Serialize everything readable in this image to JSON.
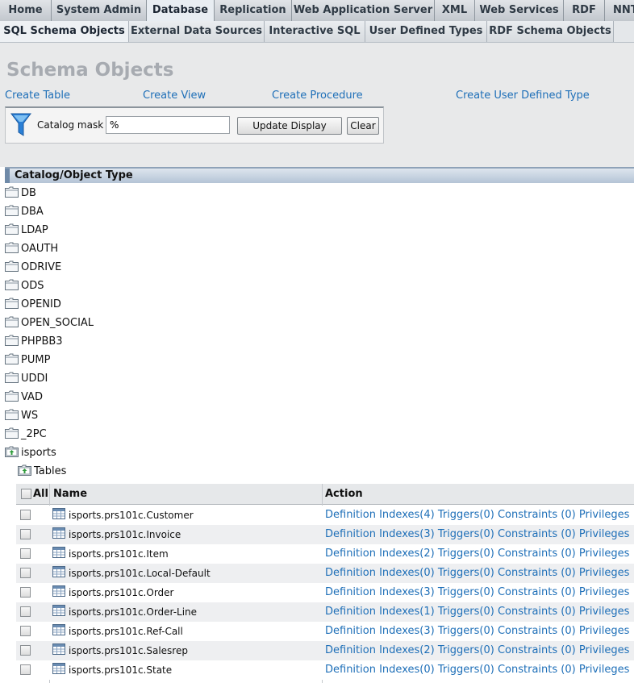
{
  "tabs": [
    "Home",
    "System Admin",
    "Database",
    "Replication",
    "Web Application Server",
    "XML",
    "Web Services",
    "RDF",
    "NNTP"
  ],
  "subtabs": [
    "SQL Schema Objects",
    "External Data Sources",
    "Interactive SQL",
    "User Defined Types",
    "RDF Schema Objects"
  ],
  "page_title": "Schema Objects",
  "create_links": [
    "Create Table",
    "Create View",
    "Create Procedure",
    "Create User Defined Type"
  ],
  "filter": {
    "label": "Catalog mask",
    "value": "%",
    "update_label": "Update Display",
    "clear_label": "Clear",
    "icon": "filter-funnel-icon"
  },
  "catalog_header": "Catalog/Object Type",
  "catalogs": [
    "DB",
    "DBA",
    "LDAP",
    "OAUTH",
    "ODRIVE",
    "ODS",
    "OPENID",
    "OPEN_SOCIAL",
    "PHPBB3",
    "PUMP",
    "UDDI",
    "VAD",
    "WS",
    "_2PC",
    "isports"
  ],
  "open_catalog_child": "Tables",
  "table": {
    "col_all": "All",
    "col_name": "Name",
    "col_action": "Action",
    "rows": [
      {
        "name": "isports.prs101c.Customer",
        "definition": "Definition",
        "indexes": "Indexes(4)",
        "triggers": "Triggers(0)",
        "constraints": "Constraints (0)",
        "privileges": "Privileges"
      },
      {
        "name": "isports.prs101c.Invoice",
        "definition": "Definition",
        "indexes": "Indexes(3)",
        "triggers": "Triggers(0)",
        "constraints": "Constraints (0)",
        "privileges": "Privileges"
      },
      {
        "name": "isports.prs101c.Item",
        "definition": "Definition",
        "indexes": "Indexes(2)",
        "triggers": "Triggers(0)",
        "constraints": "Constraints (0)",
        "privileges": "Privileges"
      },
      {
        "name": "isports.prs101c.Local-Default",
        "definition": "Definition",
        "indexes": "Indexes(0)",
        "triggers": "Triggers(0)",
        "constraints": "Constraints (0)",
        "privileges": "Privileges"
      },
      {
        "name": "isports.prs101c.Order",
        "definition": "Definition",
        "indexes": "Indexes(3)",
        "triggers": "Triggers(0)",
        "constraints": "Constraints (0)",
        "privileges": "Privileges"
      },
      {
        "name": "isports.prs101c.Order-Line",
        "definition": "Definition",
        "indexes": "Indexes(1)",
        "triggers": "Triggers(0)",
        "constraints": "Constraints (0)",
        "privileges": "Privileges"
      },
      {
        "name": "isports.prs101c.Ref-Call",
        "definition": "Definition",
        "indexes": "Indexes(3)",
        "triggers": "Triggers(0)",
        "constraints": "Constraints (0)",
        "privileges": "Privileges"
      },
      {
        "name": "isports.prs101c.Salesrep",
        "definition": "Definition",
        "indexes": "Indexes(2)",
        "triggers": "Triggers(0)",
        "constraints": "Constraints (0)",
        "privileges": "Privileges"
      },
      {
        "name": "isports.prs101c.State",
        "definition": "Definition",
        "indexes": "Indexes(0)",
        "triggers": "Triggers(0)",
        "constraints": "Constraints (0)",
        "privileges": "Privileges"
      }
    ]
  },
  "colors": {
    "link": "#1e6fb8",
    "header_blue": "#b4c4d6",
    "title_gray": "#a7abb1"
  }
}
